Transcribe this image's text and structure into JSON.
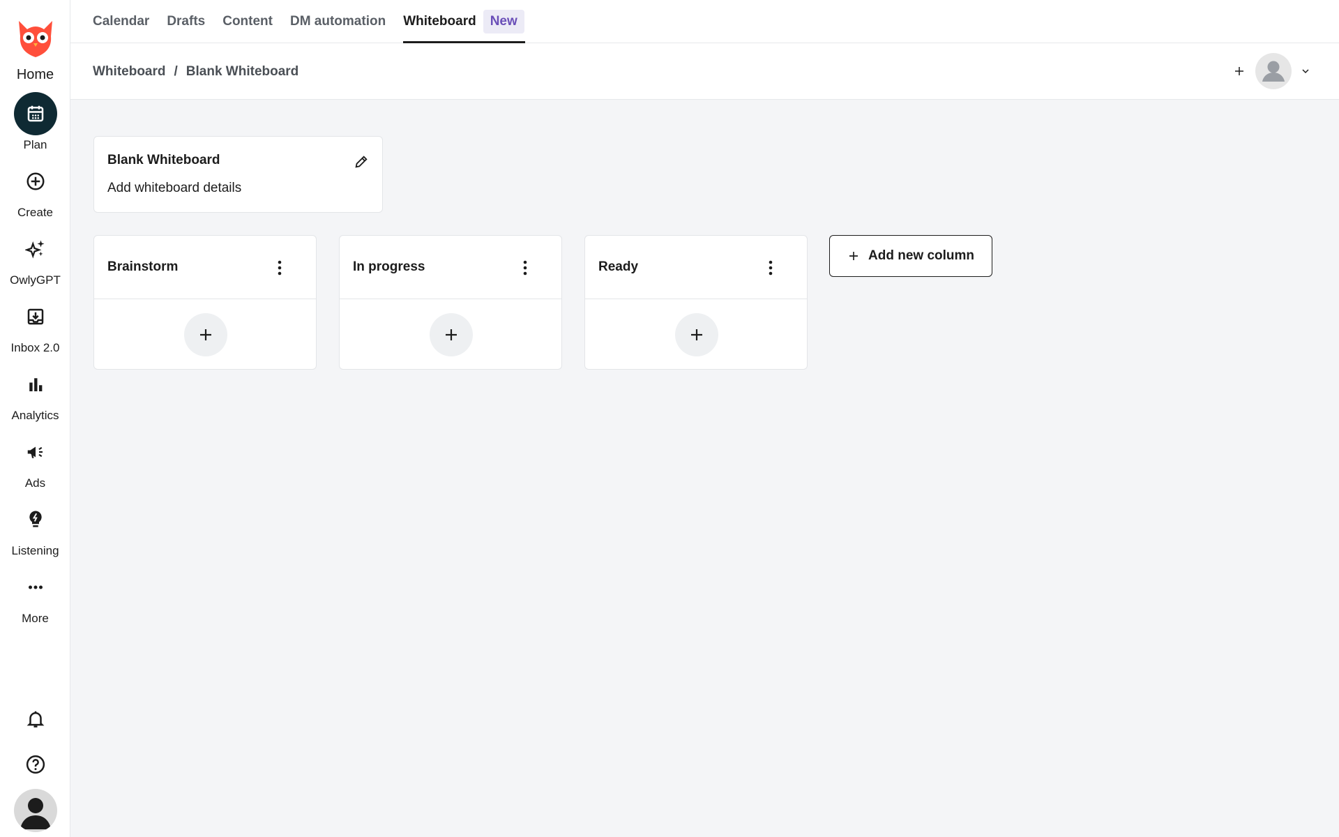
{
  "sidebar": {
    "home_label": "Home",
    "items": [
      {
        "label": "Plan",
        "icon": "calendar-icon"
      },
      {
        "label": "Create",
        "icon": "plus-circle-icon"
      },
      {
        "label": "OwlyGPT",
        "icon": "sparkle-icon"
      },
      {
        "label": "Inbox 2.0",
        "icon": "inbox-icon"
      },
      {
        "label": "Analytics",
        "icon": "bar-chart-icon"
      },
      {
        "label": "Ads",
        "icon": "megaphone-icon"
      },
      {
        "label": "Listening",
        "icon": "bulb-icon"
      },
      {
        "label": "More",
        "icon": "more-icon"
      }
    ],
    "bottom_icons": [
      "bell-icon",
      "help-icon"
    ],
    "brand_color": "#ff4f3b"
  },
  "tabs": {
    "items": [
      "Calendar",
      "Drafts",
      "Content",
      "DM automation",
      "Whiteboard"
    ],
    "active": "Whiteboard",
    "new_badge": "New"
  },
  "breadcrumb": {
    "root": "Whiteboard",
    "separator": "/",
    "current": "Blank Whiteboard"
  },
  "whiteboard": {
    "title": "Blank Whiteboard",
    "details_placeholder": "Add whiteboard details"
  },
  "columns": [
    {
      "title": "Brainstorm"
    },
    {
      "title": "In progress"
    },
    {
      "title": "Ready"
    }
  ],
  "add_column_label": "Add new column",
  "colors": {
    "accent_dark": "#0f2a33",
    "badge_text": "#6a4fb8",
    "badge_bg": "#ecebf6",
    "background": "#f4f5f7"
  }
}
